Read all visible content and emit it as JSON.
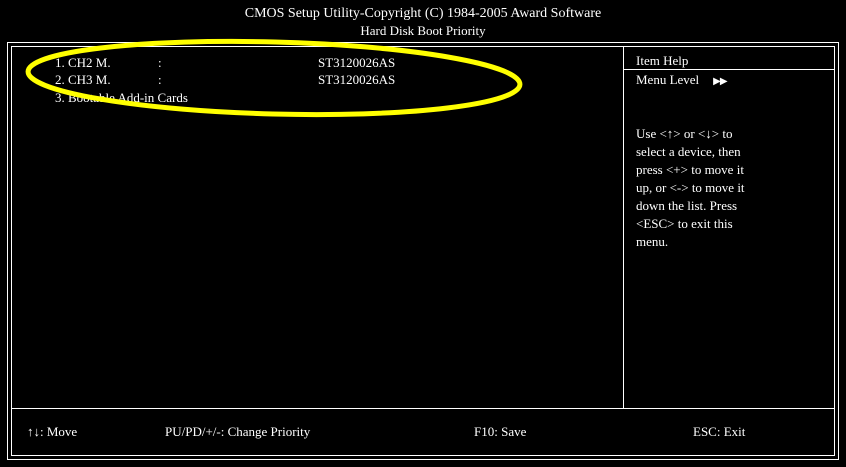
{
  "header": {
    "title": "CMOS Setup Utility-Copyright (C) 1984-2005 Award Software",
    "subtitle": "Hard Disk Boot Priority"
  },
  "devices": [
    {
      "name": "1. CH2 M.",
      "colon": ":",
      "value": "ST3120026AS"
    },
    {
      "name": "2. CH3 M.",
      "colon": ":",
      "value": "ST3120026AS"
    },
    {
      "name": "3. Bootable Add-in Cards",
      "colon": "",
      "value": ""
    }
  ],
  "help": {
    "title": "Item Help",
    "menu_level": "Menu Level",
    "menu_level_arrows": "▶▶",
    "text": "Use <↑>   or <↓> to\nselect a device, then\npress <+> to move it\nup, or <-> to move it\ndown the list. Press\n<ESC> to exit this\nmenu."
  },
  "footer": {
    "move": "↑↓: Move",
    "change_priority": "PU/PD/+/-: Change Priority",
    "save": "F10: Save",
    "exit": "ESC: Exit"
  },
  "colors": {
    "background": "#000000",
    "text": "#ffffff",
    "highlight_ellipse": "#ffff00"
  }
}
